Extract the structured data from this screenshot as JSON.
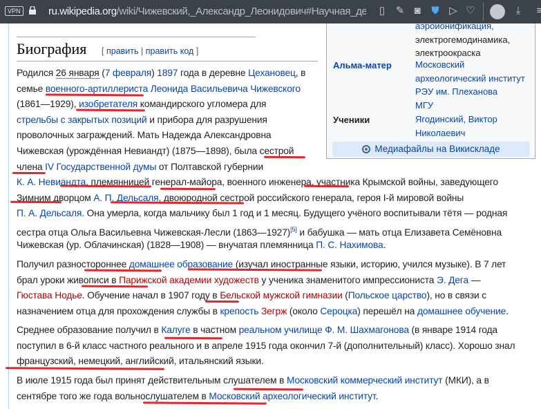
{
  "browser": {
    "vpn_label": "VPN",
    "url_domain": "ru.wikipedia.org",
    "url_path": "/wiki/Чижевский,_Александр_Леонидович#Научная_деятельно",
    "icons": [
      "reader-icon",
      "edit-icon",
      "camera-icon",
      "shield-icon",
      "send-icon",
      "heart-icon",
      "profile-icon",
      "download-icon",
      "menu-icon"
    ]
  },
  "infobox": {
    "top_values": [
      "аэроионификация,",
      "электрогемодинамика,",
      "электроокраска"
    ],
    "alma_mater_label": "Альма-матер",
    "alma_mater": [
      "Московский",
      "археологический институт",
      "РЭУ им. Плеханова",
      "МГУ"
    ],
    "students_label": "Ученики",
    "students": [
      "Ягодинский, Виктор",
      "Николаевич"
    ],
    "commons_link": "Медиафайлы на Викискладе"
  },
  "section": {
    "title": "Биография",
    "edit_open": "[",
    "edit": "править",
    "edit_sep": "|",
    "edit_code": "править код",
    "edit_close": "]"
  },
  "paragraphs": [
    [
      [
        [
          "t",
          "Родился "
        ],
        [
          "d",
          "26 января"
        ],
        [
          "t",
          " ("
        ],
        [
          "l",
          "7 февраля"
        ],
        [
          "t",
          ") "
        ],
        [
          "l",
          "1897"
        ],
        [
          "t",
          " года в деревне "
        ],
        [
          "l",
          "Цехановец"
        ],
        [
          "t",
          ", в"
        ]
      ],
      [
        [
          "t",
          "семье "
        ],
        [
          "l",
          "военного-артиллериста"
        ],
        [
          "t",
          " "
        ],
        [
          "l",
          "Леонида Васильевича Чижевского"
        ]
      ],
      [
        [
          "t",
          "(1861—1929), "
        ],
        [
          "l",
          "изобретателя"
        ],
        [
          "t",
          " командирского угломера для"
        ]
      ],
      [
        [
          "l",
          "стрельбы с закрытых позиций"
        ],
        [
          "t",
          " и прибора для разрушения"
        ]
      ],
      [
        [
          "t",
          "проволочных заграждений. Мать Надежда Александровна"
        ]
      ],
      [
        [
          "t",
          "Чижевская (урождённая Невиандт) (1875—1898), была сестрой"
        ]
      ],
      [
        [
          "t",
          "члена "
        ],
        [
          "l",
          "IV Государственной думы"
        ],
        [
          "t",
          " от Полтавской губернии"
        ]
      ],
      [
        [
          "l",
          "К. А. Невиандта"
        ],
        [
          "t",
          ", племянницей генерал-майора, военного инженера, участника Крымской войны, заведующего"
        ]
      ],
      [
        [
          "t",
          "Зимним дворцом "
        ],
        [
          "l",
          "А. П. Дельсаля"
        ],
        [
          "t",
          ", двоюродной сестрой российского генерала, героя I-й мировой войны"
        ]
      ],
      [
        [
          "l",
          "П. А. Дельсаля"
        ],
        [
          "t",
          ". Она умерла, когда мальчику был 1 год и 1 месяц. Будущего учёного воспитывали тётя — родная"
        ]
      ],
      [
        [
          "t",
          "сестра отца Ольга Васильевна Чижевская-Лесли (1863—1927)"
        ],
        [
          "s",
          "[5]"
        ],
        [
          "t",
          " и бабушка — мать отца Елизавета Семёновна"
        ]
      ],
      [
        [
          "t",
          "Чижевская (ур. Облачинская) (1828—1908) — внучатая племянница "
        ],
        [
          "l",
          "П. С. Нахимова"
        ],
        [
          "t",
          "."
        ]
      ]
    ],
    [
      [
        [
          "t",
          "Получил разностороннее "
        ],
        [
          "l",
          "домашнее образование"
        ],
        [
          "t",
          " (изучал иностранные языки, историю, учился музыке). В 7 лет"
        ]
      ],
      [
        [
          "t",
          "брал уроки живописи в "
        ],
        [
          "r",
          "Парижской академии художеств"
        ],
        [
          "t",
          " у ученика знаменитого импрессиониста "
        ],
        [
          "l",
          "Э. Дега"
        ],
        [
          "t",
          " —"
        ]
      ],
      [
        [
          "r",
          "Гюстава Нодье"
        ],
        [
          "t",
          ". Обучение начал в 1907 году в "
        ],
        [
          "r",
          "Бельской мужской гимназии"
        ],
        [
          "t",
          " ("
        ],
        [
          "l",
          "Польское царство"
        ],
        [
          "t",
          "), но в связи с"
        ]
      ],
      [
        [
          "t",
          "назначением отца для прохождения службы в "
        ],
        [
          "l",
          "крепость"
        ],
        [
          "t",
          " "
        ],
        [
          "r",
          "Зегрж"
        ],
        [
          "t",
          " (около "
        ],
        [
          "l",
          "Сероцка"
        ],
        [
          "t",
          ") перешёл на "
        ],
        [
          "l",
          "домашнее обучение"
        ],
        [
          "t",
          "."
        ]
      ]
    ],
    [
      [
        [
          "t",
          "Среднее образование получил в "
        ],
        [
          "l",
          "Калуге"
        ],
        [
          "t",
          " в частном "
        ],
        [
          "l",
          "реальном училище"
        ],
        [
          "t",
          " "
        ],
        [
          "l",
          "Ф. М. Шахмагонова"
        ],
        [
          "t",
          " (в январе 1914 года"
        ]
      ],
      [
        [
          "t",
          "поступил в 6-й класс частного реального и в апреле 1915 года окончил 7-й (дополнительный) класс). Хорошо знал"
        ]
      ],
      [
        [
          "t",
          "французский, немецкий, английский, итальянский языки."
        ]
      ]
    ],
    [
      [
        [
          "t",
          "В июле 1915 года был принят действительным слушателем в "
        ],
        [
          "l",
          "Московский коммерческий институт"
        ],
        [
          "t",
          " (МКИ), а в"
        ]
      ],
      [
        [
          "t",
          "сентябре того же года вольнослушателем в "
        ],
        [
          "l",
          "Московский археологический институт"
        ],
        [
          "t",
          "."
        ]
      ]
    ]
  ]
}
